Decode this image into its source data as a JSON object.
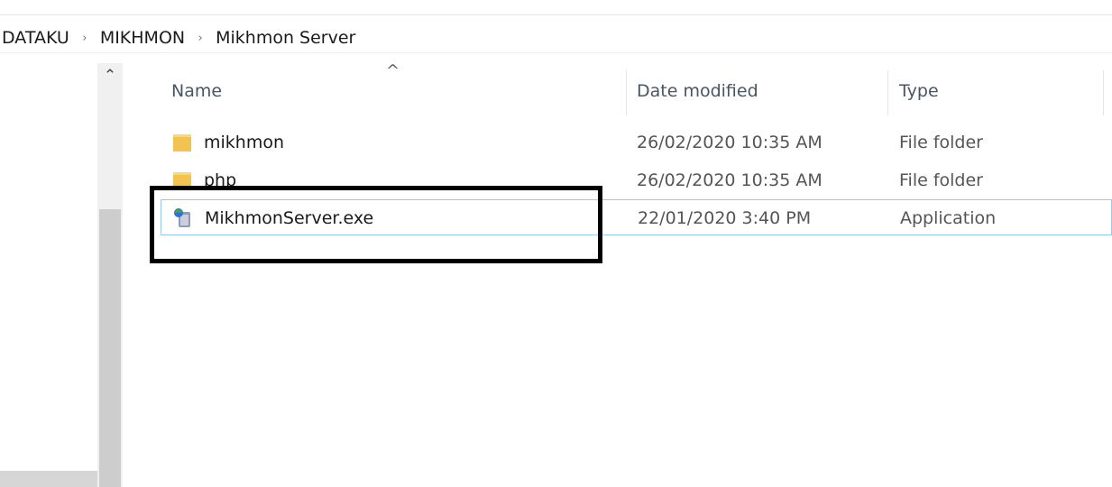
{
  "breadcrumb": {
    "items": [
      "DATAKU",
      "MIKHMON",
      "Mikhmon Server"
    ],
    "separator": "›"
  },
  "columns": {
    "name": "Name",
    "date": "Date modified",
    "type": "Type",
    "sort": "ascending"
  },
  "files": [
    {
      "name": "mikhmon",
      "date": "26/02/2020 10:35 AM",
      "type": "File folder",
      "icon": "folder-icon"
    },
    {
      "name": "php",
      "date": "26/02/2020 10:35 AM",
      "type": "File folder",
      "icon": "folder-icon"
    },
    {
      "name": "MikhmonServer.exe",
      "date": "22/01/2020 3:40 PM",
      "type": "Application",
      "icon": "application-icon"
    }
  ],
  "colors": {
    "focus_border": "#99c9ef",
    "folder": "#f3c351",
    "annotation": "#000000"
  }
}
